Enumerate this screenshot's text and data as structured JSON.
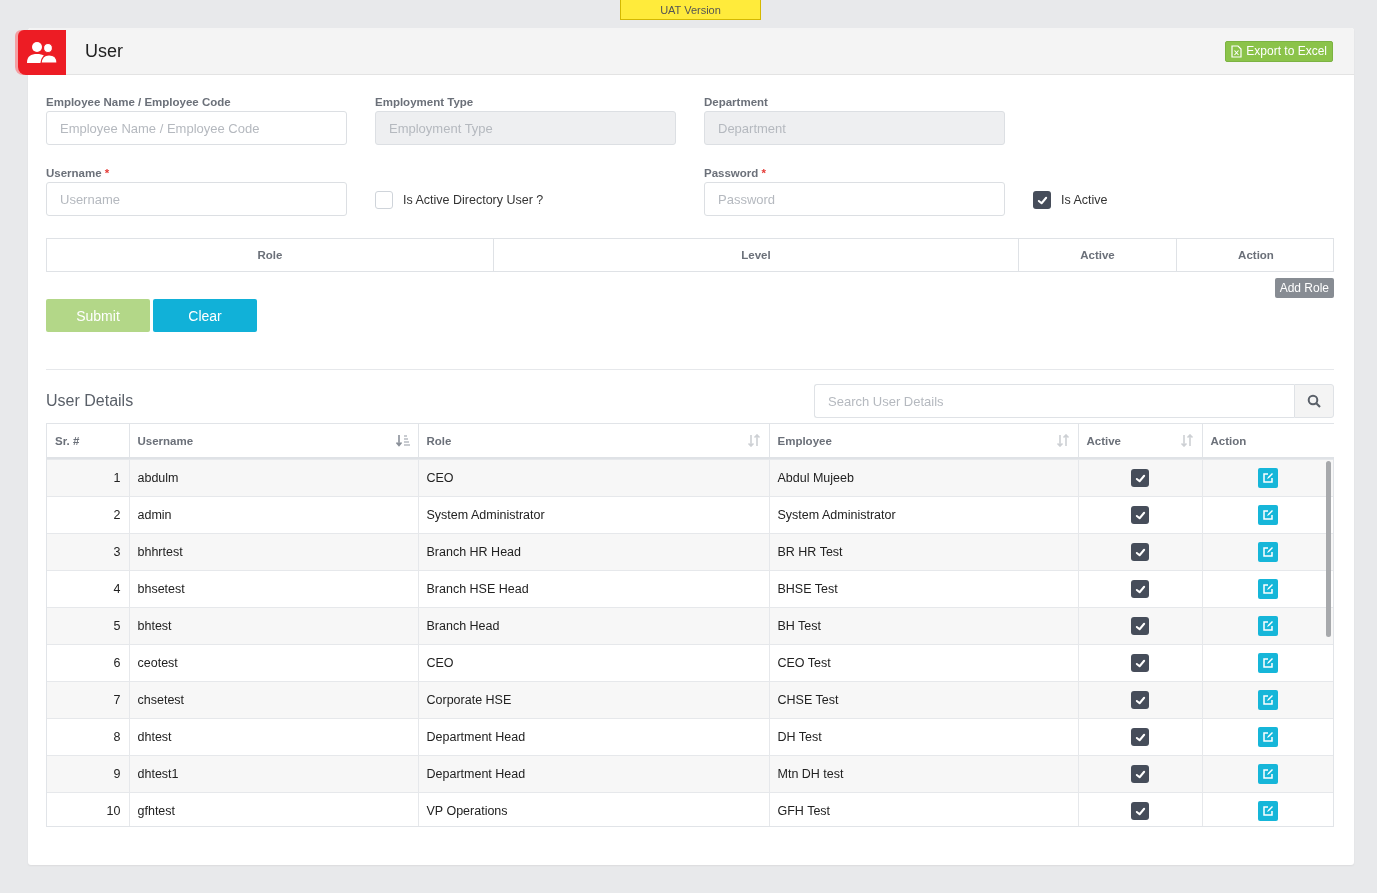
{
  "environment_badge": "UAT Version",
  "header": {
    "title": "User",
    "export_button": "Export to Excel"
  },
  "form": {
    "fields": [
      {
        "kind": "input",
        "label": "Employee Name / Employee Code",
        "placeholder": "Employee Name / Employee Code",
        "required": false,
        "disabled": false
      },
      {
        "kind": "input",
        "label": "Employment Type",
        "placeholder": "Employment Type",
        "required": false,
        "disabled": true
      },
      {
        "kind": "input",
        "label": "Department",
        "placeholder": "Department",
        "required": false,
        "disabled": true
      },
      {
        "kind": "spacer"
      },
      {
        "kind": "input",
        "label": "Username",
        "placeholder": "Username",
        "required": true,
        "disabled": false
      },
      {
        "kind": "checkbox",
        "label": "Is Active Directory User ?",
        "checked": false
      },
      {
        "kind": "input",
        "label": "Password",
        "placeholder": "Password",
        "required": true,
        "disabled": false
      },
      {
        "kind": "checkbox",
        "label": "Is Active",
        "checked": true
      }
    ],
    "required_mark": "*"
  },
  "role_table": {
    "columns": [
      "Role",
      "Level",
      "Active",
      "Action"
    ],
    "add_button": "Add Role"
  },
  "actions": [
    {
      "label": "Submit",
      "kind": "submit",
      "disabled": true
    },
    {
      "label": "Clear",
      "kind": "clear",
      "disabled": false
    }
  ],
  "users": {
    "title": "User Details",
    "search_placeholder": "Search User Details",
    "columns": [
      {
        "label": "Sr. #",
        "sortable": false,
        "sorted": false
      },
      {
        "label": "Username",
        "sortable": true,
        "sorted": true
      },
      {
        "label": "Role",
        "sortable": true,
        "sorted": false
      },
      {
        "label": "Employee",
        "sortable": true,
        "sorted": false
      },
      {
        "label": "Active",
        "sortable": true,
        "sorted": false
      },
      {
        "label": "Action",
        "sortable": false,
        "sorted": false
      }
    ],
    "rows": [
      {
        "sr": "1",
        "username": "abdulm",
        "role": "CEO",
        "employee": "Abdul Mujeeb",
        "active": true
      },
      {
        "sr": "2",
        "username": "admin",
        "role": "System Administrator",
        "employee": "System Administrator",
        "active": true
      },
      {
        "sr": "3",
        "username": "bhhrtest",
        "role": "Branch HR Head",
        "employee": "BR HR Test",
        "active": true
      },
      {
        "sr": "4",
        "username": "bhsetest",
        "role": "Branch HSE Head",
        "employee": "BHSE Test",
        "active": true
      },
      {
        "sr": "5",
        "username": "bhtest",
        "role": "Branch Head",
        "employee": "BH Test",
        "active": true
      },
      {
        "sr": "6",
        "username": "ceotest",
        "role": "CEO",
        "employee": "CEO Test",
        "active": true
      },
      {
        "sr": "7",
        "username": "chsetest",
        "role": "Corporate HSE",
        "employee": "CHSE Test",
        "active": true
      },
      {
        "sr": "8",
        "username": "dhtest",
        "role": "Department Head",
        "employee": "DH Test",
        "active": true
      },
      {
        "sr": "9",
        "username": "dhtest1",
        "role": "Department Head",
        "employee": "Mtn DH test",
        "active": true
      },
      {
        "sr": "10",
        "username": "gfhtest",
        "role": "VP Operations",
        "employee": "GFH Test",
        "active": true
      }
    ]
  }
}
